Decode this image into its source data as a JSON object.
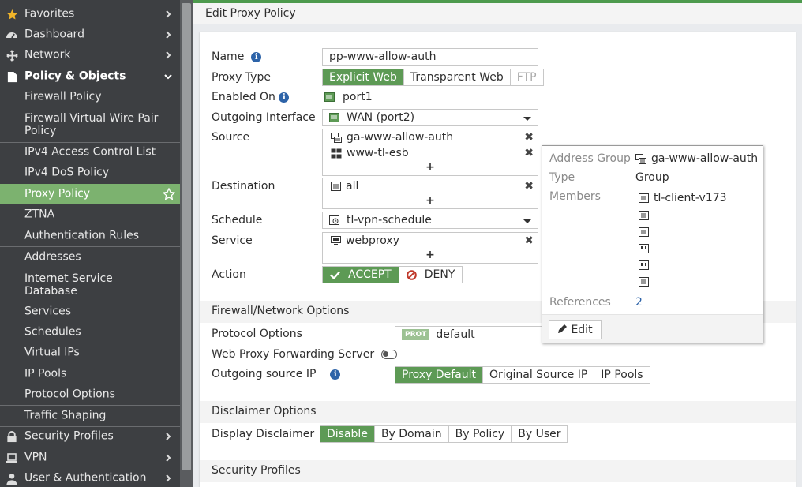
{
  "sidebar": {
    "items": [
      {
        "label": "Favorites",
        "icon": "star-icon"
      },
      {
        "label": "Dashboard",
        "icon": "dashboard-icon"
      },
      {
        "label": "Network",
        "icon": "network-icon"
      },
      {
        "label": "Policy & Objects",
        "icon": "policy-icon"
      },
      {
        "label": "Firewall Policy"
      },
      {
        "label": "Firewall Virtual Wire Pair Policy"
      },
      {
        "label": "IPv4 Access Control List"
      },
      {
        "label": "IPv4 DoS Policy"
      },
      {
        "label": "Proxy Policy"
      },
      {
        "label": "ZTNA"
      },
      {
        "label": "Authentication Rules"
      },
      {
        "label": "Addresses"
      },
      {
        "label": "Internet Service Database"
      },
      {
        "label": "Services"
      },
      {
        "label": "Schedules"
      },
      {
        "label": "Virtual IPs"
      },
      {
        "label": "IP Pools"
      },
      {
        "label": "Protocol Options"
      },
      {
        "label": "Traffic Shaping"
      },
      {
        "label": "Security Profiles",
        "icon": "lock-icon"
      },
      {
        "label": "VPN",
        "icon": "laptop-icon"
      },
      {
        "label": "User & Authentication",
        "icon": "user-icon"
      }
    ]
  },
  "header": {
    "title": "Edit Proxy Policy"
  },
  "form": {
    "name_label": "Name",
    "name_value": "pp-www-allow-auth",
    "proxy_type_label": "Proxy Type",
    "proxy_types": [
      "Explicit Web",
      "Transparent Web",
      "FTP"
    ],
    "enabled_on_label": "Enabled On",
    "enabled_on_value": "port1",
    "outgoing_label": "Outgoing Interface",
    "outgoing_value": "WAN (port2)",
    "source_label": "Source",
    "source_items": [
      "ga-www-allow-auth",
      "www-tl-esb"
    ],
    "destination_label": "Destination",
    "destination_items": [
      "all"
    ],
    "schedule_label": "Schedule",
    "schedule_value": "tl-vpn-schedule",
    "service_label": "Service",
    "service_items": [
      "webproxy"
    ],
    "action_label": "Action",
    "accept_label": "ACCEPT",
    "deny_label": "DENY",
    "plus": "+",
    "remove": "✖"
  },
  "firewall_options": {
    "title": "Firewall/Network Options",
    "protocol_options_label": "Protocol Options",
    "protocol_badge": "PROT",
    "protocol_value": "default",
    "forwarding_label": "Web Proxy Forwarding Server",
    "outgoing_ip_label": "Outgoing source IP",
    "outgoing_ip_options": [
      "Proxy Default",
      "Original Source IP",
      "IP Pools"
    ]
  },
  "disclaimer": {
    "title": "Disclaimer Options",
    "display_label": "Display Disclaimer",
    "options": [
      "Disable",
      "By Domain",
      "By Policy",
      "By User"
    ]
  },
  "security_profiles": {
    "title": "Security Profiles"
  },
  "popup": {
    "address_group_label": "Address Group",
    "address_group_value": "ga-www-allow-auth",
    "type_label": "Type",
    "type_value": "Group",
    "members_label": "Members",
    "first_member": "tl-client-v173",
    "references_label": "References",
    "references_value": "2",
    "edit_label": "Edit"
  },
  "colors": {
    "accent": "#5d9a55",
    "active_nav": "#7cb26f",
    "sidebar": "#3d3f42",
    "link": "#2d63a8"
  }
}
